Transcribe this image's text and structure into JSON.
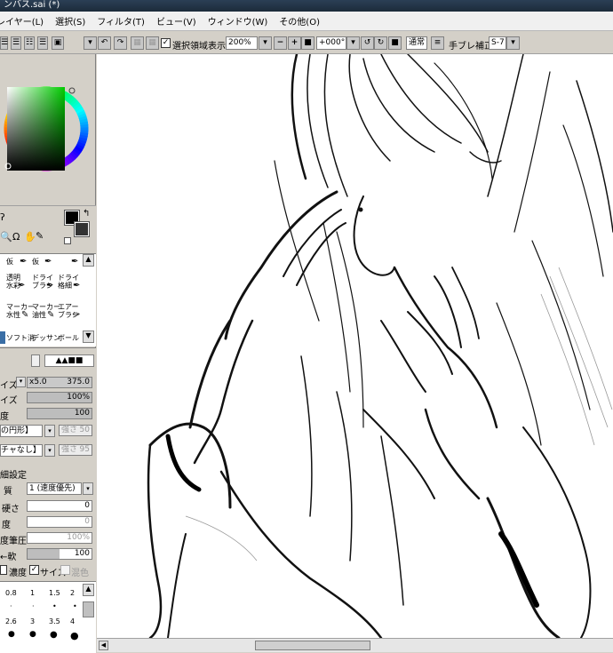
{
  "window": {
    "title": "ンバス.sai (*)"
  },
  "menu": [
    "レイヤー(L)",
    "選択(S)",
    "フィルタ(T)",
    "ビュー(V)",
    "ウィンドウ(W)",
    "その他(O)"
  ],
  "toolbar": {
    "selection_label": "選択領域表示",
    "selection_checked": true,
    "zoom": "200%",
    "rotation": "+000°",
    "blend_mode": "通常",
    "stabilizer_label": "手ブレ補正",
    "stabilizer_value": "S-7"
  },
  "brushes": {
    "row1": [
      "仮",
      "仮"
    ],
    "row2": [
      [
        "透明",
        "水彩"
      ],
      [
        "ドライ",
        "ブラシ"
      ],
      [
        "ドライ",
        "格細"
      ]
    ],
    "row3": [
      [
        "マーカー",
        "水性"
      ],
      [
        "マーカー",
        "油性"
      ],
      [
        "エアー",
        "ブラシ"
      ]
    ],
    "row4": [
      "ソフト消",
      "デッサン",
      "ボール"
    ]
  },
  "brush_settings": {
    "size_label": "イズ",
    "size_mult": "x5.0",
    "size_value": "375.0",
    "min_size_label": "イズ",
    "min_size_value": "100%",
    "density_label": "度",
    "density_value": "100",
    "shape_label": "の円形】",
    "shape_strength_label": "強さ",
    "shape_strength_value": "50",
    "texture_label": "チャなし】",
    "texture_strength_label": "強さ",
    "texture_strength_value": "95",
    "advanced_label": "細設定",
    "quality_label": "質",
    "quality_value": "1 (速度優先)",
    "edge_label": "硬さ",
    "edge_value": "0",
    "min_density_label": "度",
    "min_density_value": "0",
    "max_pressure_label": "度筆圧",
    "max_pressure_value": "100%",
    "pressure_label": "←軟",
    "pressure_value": "100",
    "check_density": "濃度",
    "check_size": "サイズ",
    "check_blend": "混色"
  },
  "size_presets": {
    "row1": [
      "0.8",
      "1",
      "1.5",
      "2"
    ],
    "row2": [
      "2.6",
      "3",
      "3.5",
      "4"
    ]
  },
  "colors": {
    "primary": "#000000",
    "secondary": "#333333",
    "hue_square": "#00cc00"
  }
}
